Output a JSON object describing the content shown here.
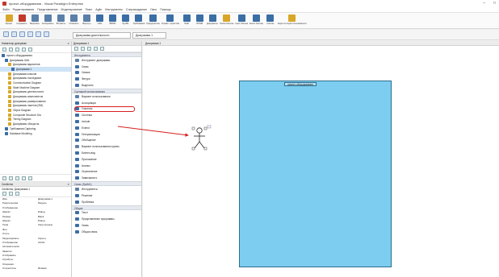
{
  "window": {
    "title": "проект-оборудования - Visual Paradigm Enterprise",
    "controls": [
      "–",
      "□"
    ]
  },
  "menubar": [
    "Файл",
    "Редактирование",
    "Представление",
    "Моделирование",
    "Team",
    "Agile",
    "Инструменты",
    "Сопровождение",
    "Окно",
    "Помощь"
  ],
  "ribbon": [
    {
      "label": "Проект",
      "color": "#d8a72a"
    },
    {
      "label": "Сохранить",
      "color": "#c0392b"
    },
    {
      "label": "Вырезать",
      "color": "#5b7fa8"
    },
    {
      "label": "Копировать",
      "color": "#5b7fa8"
    },
    {
      "label": "Вставить",
      "color": "#5b7fa8"
    },
    {
      "label": "Отменить",
      "color": "#5b7fa8"
    },
    {
      "label": "Вернуть",
      "color": "#5b7fa8"
    },
    {
      "label": "UML",
      "color": "#3b6ea5"
    },
    {
      "label": "BPMN",
      "color": "#3b6ea5"
    },
    {
      "label": "SysML",
      "color": "#3b6ea5"
    },
    {
      "label": "Требования",
      "color": "#3b6ea5"
    },
    {
      "label": "Предприятие",
      "color": "#3b6ea5"
    },
    {
      "label": "Управл. проектом",
      "color": "#3b6ea5"
    },
    {
      "label": "Swift",
      "color": "#3b6ea5"
    },
    {
      "label": "OPNM",
      "color": "#3b6ea5"
    },
    {
      "label": "Документы",
      "color": "#3b6ea5"
    },
    {
      "label": "Social Canvas",
      "color": "#d8a72a"
    },
    {
      "label": "Lean Canvas",
      "color": "#3b6ea5"
    },
    {
      "label": "Event Canvas",
      "color": "#3b6ea5"
    },
    {
      "label": "Canvas",
      "color": "#3b6ea5"
    },
    {
      "label": "Карта истории пользователя",
      "color": "#d8a72a"
    }
  ],
  "tabs": {
    "diagram_nav": "Диаграмма деятельности",
    "active_doc": "Диаграмма 1"
  },
  "left_panel": {
    "header": "Навигатор диаграмм",
    "tree": [
      {
        "label": "проект-оборудования",
        "sel": false,
        "indent": 0,
        "color": "#3b6ea5"
      },
      {
        "label": "Диаграммы UML",
        "sel": false,
        "indent": 1,
        "color": "#3b6ea5"
      },
      {
        "label": "Диаграммы вариантов",
        "sel": false,
        "indent": 2,
        "color": "#d8a72a"
      },
      {
        "label": "Диаграмма 1",
        "sel": true,
        "indent": 3,
        "color": "#3b6ea5"
      },
      {
        "label": "Диаграмма классов",
        "sel": false,
        "indent": 2,
        "color": "#d8a72a"
      },
      {
        "label": "Диаграммы последоват.",
        "sel": false,
        "indent": 2,
        "color": "#d8a72a"
      },
      {
        "label": "Communication Diagram",
        "sel": false,
        "indent": 2,
        "color": "#d8a72a"
      },
      {
        "label": "State Machine Diagram",
        "sel": false,
        "indent": 2,
        "color": "#d8a72a"
      },
      {
        "label": "Диаграммы деятельности",
        "sel": false,
        "indent": 2,
        "color": "#d8a72a"
      },
      {
        "label": "Диаграммы компонентов",
        "sel": false,
        "indent": 2,
        "color": "#d8a72a"
      },
      {
        "label": "Диаграммы развертывания",
        "sel": false,
        "indent": 2,
        "color": "#d8a72a"
      },
      {
        "label": "Диаграммы пакетов (SM)",
        "sel": false,
        "indent": 2,
        "color": "#d8a72a"
      },
      {
        "label": "Object Diagram",
        "sel": false,
        "indent": 2,
        "color": "#d8a72a"
      },
      {
        "label": "Composite Structure Dia",
        "sel": false,
        "indent": 2,
        "color": "#d8a72a"
      },
      {
        "label": "Timing Diagram",
        "sel": false,
        "indent": 2,
        "color": "#d8a72a"
      },
      {
        "label": "Диаграммы обзора вз.",
        "sel": false,
        "indent": 2,
        "color": "#d8a72a"
      },
      {
        "label": "Требования Capturing",
        "sel": false,
        "indent": 1,
        "color": "#3b6ea5"
      },
      {
        "label": "Database Modeling",
        "sel": false,
        "indent": 1,
        "color": "#3b6ea5"
      }
    ],
    "props_header": "Свойства",
    "props_title": "Свойства: Диаграмма 1",
    "props": [
      {
        "k": "Имя",
        "v": "Диаграмма 1"
      },
      {
        "k": "Родительская",
        "v": "Модель"
      },
      {
        "k": "Отображение",
        "v": ""
      },
      {
        "k": "Шрифт",
        "v": "Dialog"
      },
      {
        "k": "Размер",
        "v": "Black"
      },
      {
        "k": "Шрифт",
        "v": "Dialog"
      },
      {
        "k": "Тема",
        "v": "Скругленные"
      },
      {
        "k": "Фон",
        "v": ""
      },
      {
        "k": "Стиль",
        "v": ""
      },
      {
        "k": "Моделировать",
        "v": "Скрыть"
      },
      {
        "k": "Отображение",
        "v": "ACCE"
      },
      {
        "k": "Автоматически",
        "v": ""
      },
      {
        "k": "Заметки",
        "v": ""
      },
      {
        "k": "Отображать",
        "v": ""
      },
      {
        "k": "Атрибуты",
        "v": ""
      },
      {
        "k": "Операции",
        "v": ""
      },
      {
        "k": "Стереотипы",
        "v": "Флажки"
      }
    ]
  },
  "palette": {
    "header": "Диаграмма 1",
    "items": [
      {
        "label": "Инструменты",
        "head": true,
        "color": ""
      },
      {
        "label": "Инструмент диаграммы",
        "head": false,
        "color": "#5b7fa8"
      },
      {
        "label": "Связь",
        "head": false,
        "color": "#3b6ea5"
      },
      {
        "label": "Связка",
        "head": false,
        "color": "#3b6ea5"
      },
      {
        "label": "Фигура",
        "head": false,
        "color": "#3b6ea5"
      },
      {
        "label": "Выделить",
        "head": false,
        "color": "#3b6ea5"
      },
      {
        "label": "Сценарий использования",
        "head": true,
        "color": ""
      },
      {
        "label": "Вариант использования",
        "head": false,
        "color": "#5b7fa8"
      },
      {
        "label": "Ассоциация",
        "head": false,
        "color": "#3b6ea5"
      },
      {
        "label": "Участник",
        "head": false,
        "color": "#3b6ea5",
        "hl": true
      },
      {
        "label": "Система",
        "head": false,
        "color": "#3b6ea5"
      },
      {
        "label": "Include",
        "head": false,
        "color": "#3b6ea5"
      },
      {
        "label": "Extend",
        "head": false,
        "color": "#3b6ea5"
      },
      {
        "label": "Генерализация",
        "head": false,
        "color": "#3b6ea5"
      },
      {
        "label": "Обобщение",
        "head": false,
        "color": "#3b6ea5"
      },
      {
        "label": "Вариант использования группы",
        "head": false,
        "color": "#5b7fa8"
      },
      {
        "label": "Бизнес-вид",
        "head": false,
        "color": "#3b6ea5"
      },
      {
        "label": "Приложение",
        "head": false,
        "color": "#3b6ea5"
      },
      {
        "label": "Анализ",
        "head": false,
        "color": "#3b6ea5"
      },
      {
        "label": "Ограничение",
        "head": false,
        "color": "#3b6ea5"
      },
      {
        "label": "Зависимость",
        "head": false,
        "color": "#3b6ea5"
      },
      {
        "label": "Связь (SysML)",
        "head": true,
        "color": ""
      },
      {
        "label": "Инструменты",
        "head": false,
        "color": "#5b7fa8"
      },
      {
        "label": "Решение",
        "head": false,
        "color": "#3b6ea5"
      },
      {
        "label": "Проблема",
        "head": false,
        "color": "#3b6ea5"
      },
      {
        "label": "Общие",
        "head": true,
        "color": ""
      },
      {
        "label": "Текст",
        "head": false,
        "color": "#3b6ea5"
      },
      {
        "label": "Представление программы",
        "head": false,
        "color": "#3b6ea5"
      },
      {
        "label": "Связь",
        "head": false,
        "color": "#3b6ea5"
      },
      {
        "label": "Общая связь",
        "head": false,
        "color": "#3b6ea5"
      }
    ]
  },
  "canvas": {
    "header": "Диаграмма 1",
    "frame_title": "проект-оборудования"
  },
  "colors": {
    "frame_fill": "#7ccdef",
    "frame_border": "#2c6e90",
    "highlight": "#d81e1e"
  }
}
